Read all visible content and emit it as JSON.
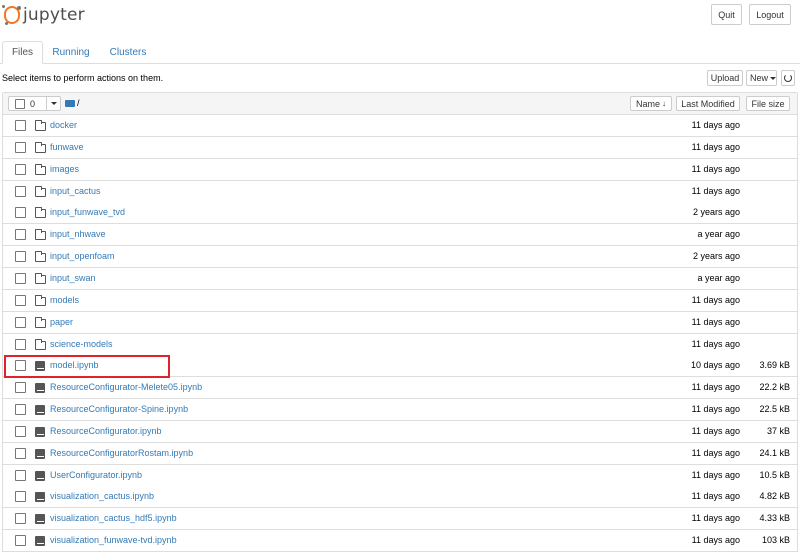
{
  "header": {
    "logo_text": "jupyter",
    "quit_label": "Quit",
    "logout_label": "Logout"
  },
  "tabs": [
    {
      "label": "Files",
      "active": true
    },
    {
      "label": "Running",
      "active": false
    },
    {
      "label": "Clusters",
      "active": false
    }
  ],
  "toolbar": {
    "hint": "Select items to perform actions on them.",
    "upload_label": "Upload",
    "new_label": "New",
    "refresh_icon": "refresh-icon"
  },
  "list_header": {
    "selected_count": "0",
    "path": "/",
    "sort_name_label": "Name",
    "last_modified_label": "Last Modified",
    "file_size_label": "File size"
  },
  "items": [
    {
      "name": "docker",
      "type": "folder",
      "modified": "11 days ago",
      "size": ""
    },
    {
      "name": "funwave",
      "type": "folder",
      "modified": "11 days ago",
      "size": ""
    },
    {
      "name": "images",
      "type": "folder",
      "modified": "11 days ago",
      "size": ""
    },
    {
      "name": "input_cactus",
      "type": "folder",
      "modified": "11 days ago",
      "size": ""
    },
    {
      "name": "input_funwave_tvd",
      "type": "folder",
      "modified": "2 years ago",
      "size": ""
    },
    {
      "name": "input_nhwave",
      "type": "folder",
      "modified": "a year ago",
      "size": ""
    },
    {
      "name": "input_openfoam",
      "type": "folder",
      "modified": "2 years ago",
      "size": ""
    },
    {
      "name": "input_swan",
      "type": "folder",
      "modified": "a year ago",
      "size": ""
    },
    {
      "name": "models",
      "type": "folder",
      "modified": "11 days ago",
      "size": ""
    },
    {
      "name": "paper",
      "type": "folder",
      "modified": "11 days ago",
      "size": ""
    },
    {
      "name": "science-models",
      "type": "folder",
      "modified": "11 days ago",
      "size": ""
    },
    {
      "name": "model.ipynb",
      "type": "notebook",
      "modified": "10 days ago",
      "size": "3.69 kB"
    },
    {
      "name": "ResourceConfigurator-Melete05.ipynb",
      "type": "notebook",
      "modified": "11 days ago",
      "size": "22.2 kB"
    },
    {
      "name": "ResourceConfigurator-Spine.ipynb",
      "type": "notebook",
      "modified": "11 days ago",
      "size": "22.5 kB"
    },
    {
      "name": "ResourceConfigurator.ipynb",
      "type": "notebook",
      "modified": "11 days ago",
      "size": "37 kB"
    },
    {
      "name": "ResourceConfiguratorRostam.ipynb",
      "type": "notebook",
      "modified": "11 days ago",
      "size": "24.1 kB"
    },
    {
      "name": "UserConfigurator.ipynb",
      "type": "notebook",
      "modified": "11 days ago",
      "size": "10.5 kB"
    },
    {
      "name": "visualization_cactus.ipynb",
      "type": "notebook",
      "modified": "11 days ago",
      "size": "4.82 kB"
    },
    {
      "name": "visualization_cactus_hdf5.ipynb",
      "type": "notebook",
      "modified": "11 days ago",
      "size": "4.33 kB"
    },
    {
      "name": "visualization_funwave-tvd.ipynb",
      "type": "notebook",
      "modified": "11 days ago",
      "size": "103 kB"
    }
  ],
  "highlighted_item": "model.ipynb",
  "colors": {
    "accent": "#f37726",
    "link": "#337ab7",
    "highlight": "#e0232a"
  }
}
